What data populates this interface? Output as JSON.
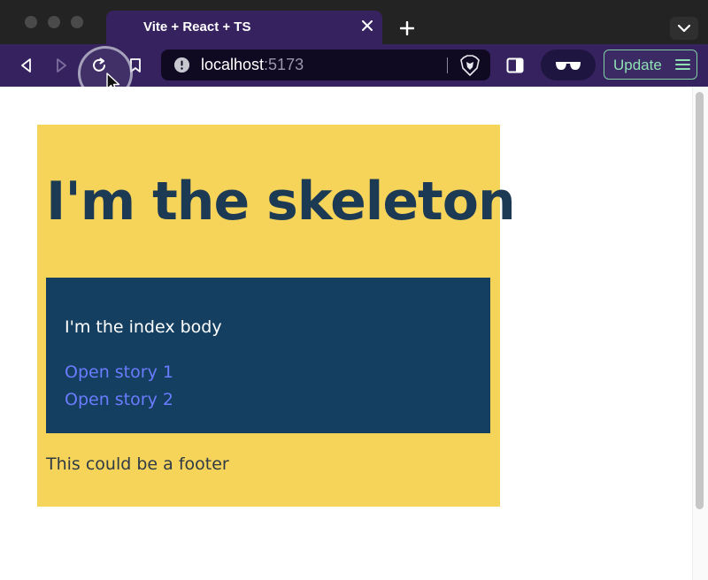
{
  "browser": {
    "tab": {
      "title": "Vite + React + TS"
    },
    "address_bar": {
      "host": "localhost",
      "port": ":5173"
    },
    "update_button": {
      "label": "Update"
    },
    "icons": {
      "back": "back-arrow-icon",
      "forward": "forward-arrow-icon",
      "reload": "reload-icon",
      "bookmark": "bookmark-icon",
      "info": "info-icon",
      "shield": "brave-shield-icon",
      "sidebar": "sidebar-toggle-icon",
      "private": "private-glasses-icon",
      "menu": "hamburger-menu-icon"
    },
    "colors": {
      "chrome": "#232323",
      "toolbar": "#36225f",
      "address_bg": "#0f0a22",
      "update_accent": "#7fd1a2"
    }
  },
  "page": {
    "skeleton": {
      "title": "I'm the skeleton",
      "index_body": {
        "text": "I'm the index body",
        "links": [
          "Open story 1",
          "Open story 2"
        ]
      },
      "footer": "This could be a footer"
    },
    "colors": {
      "skeleton_bg": "#f6d45a",
      "index_bg": "#153f60",
      "link": "#6a7cff",
      "title": "#1d3a55"
    }
  }
}
